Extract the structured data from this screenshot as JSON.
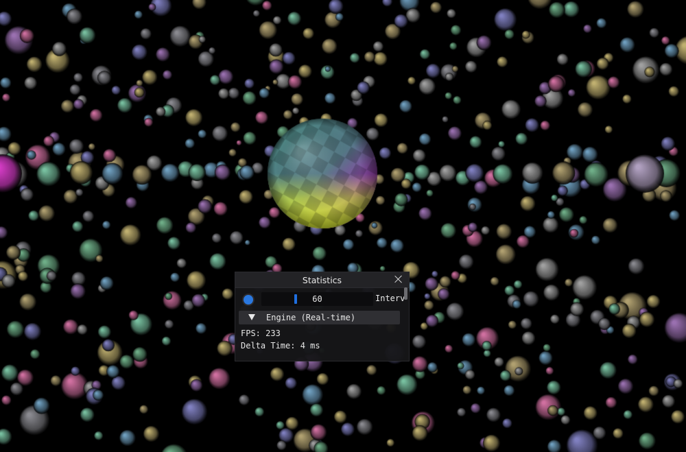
{
  "window": {
    "title": "Statistics"
  },
  "controls": {
    "slider_value": "60",
    "slider_label": "Interv",
    "slider_fraction": 0.3
  },
  "section": {
    "label": "Engine (Real-time)"
  },
  "stats": {
    "fps": "FPS: 233",
    "delta": "Delta Time: 4 ms"
  },
  "colors": {
    "accent": "#2a78e0",
    "background": "#000000"
  }
}
